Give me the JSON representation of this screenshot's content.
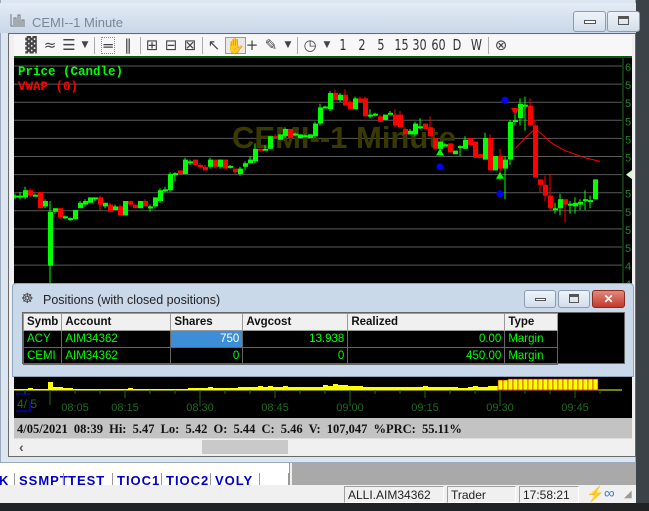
{
  "window": {
    "title": "CEMI--1 Minute",
    "watermark": "CEMI--1 Minute"
  },
  "toolbar": {
    "icons": [
      "chart-type-icon",
      "draw-style-icon",
      "indicator-icon",
      "dropdown-icon",
      "horizontal-split-icon",
      "vertical-split-icon",
      "zoom-in-icon",
      "zoom-fit-icon",
      "zoom-out-icon",
      "cursor-icon",
      "hand-icon",
      "crosshair-icon",
      "pencil-icon",
      "dropdown-icon",
      "clock-icon",
      "dropdown-icon",
      "close-circle-icon"
    ],
    "intervals": [
      "1",
      "2",
      "5",
      "15",
      "30",
      "60",
      "D",
      "W"
    ]
  },
  "legend": {
    "price": "Price (Candle)",
    "vwap": "VWAP (0)"
  },
  "colors": {
    "up": "#00ff00",
    "down": "#ff0000",
    "vwap": "#ff0000",
    "grid": "#5a5a5a",
    "axis": "#1f6b1f",
    "volume": "#ffff00",
    "watermark": "#3a3a00"
  },
  "chart_data": {
    "type": "candlestick",
    "title": "CEMI--1 Minute",
    "date_label": "4/ 5",
    "x_ticks": [
      "08:05",
      "08:15",
      "08:30",
      "08:45",
      "09:00",
      "09:15",
      "09:30",
      "09:45"
    ],
    "y_axis_labels": [
      "6.",
      "5.",
      "5.",
      "5.",
      "5.",
      "5.",
      "5.",
      "5.",
      "5.",
      "5.",
      "5.",
      "4.",
      "4"
    ],
    "ylim": [
      4.8,
      6.0
    ],
    "candles_columns": [
      "time",
      "open",
      "high",
      "low",
      "close"
    ],
    "candles": [
      [
        "07:53",
        5.27,
        5.29,
        5.26,
        5.28
      ],
      [
        "07:54",
        5.27,
        5.3,
        5.26,
        5.28
      ],
      [
        "07:55",
        5.27,
        5.33,
        5.26,
        5.31
      ],
      [
        "07:56",
        5.31,
        5.32,
        5.27,
        5.28
      ],
      [
        "07:57",
        5.28,
        5.29,
        5.28,
        5.285
      ],
      [
        "07:58",
        5.3,
        5.3,
        5.21,
        5.21
      ],
      [
        "07:59",
        5.22,
        5.26,
        5.21,
        5.25
      ],
      [
        "08:00",
        4.89,
        5.25,
        4.78,
        5.19
      ],
      [
        "08:01",
        5.19,
        5.21,
        5.18,
        5.21
      ],
      [
        "08:02",
        5.21,
        5.21,
        5.15,
        5.16
      ],
      [
        "08:03",
        5.16,
        5.17,
        5.15,
        5.165
      ],
      [
        "08:04",
        5.15,
        5.16,
        5.14,
        5.155
      ],
      [
        "08:05",
        5.15,
        5.2,
        5.15,
        5.2
      ],
      [
        "08:06",
        5.21,
        5.25,
        5.21,
        5.24
      ],
      [
        "08:07",
        5.23,
        5.26,
        5.22,
        5.25
      ],
      [
        "08:08",
        5.24,
        5.27,
        5.24,
        5.27
      ],
      [
        "08:09",
        5.26,
        5.27,
        5.25,
        5.27
      ],
      [
        "08:10",
        5.27,
        5.28,
        5.2,
        5.23
      ],
      [
        "08:11",
        5.22,
        5.24,
        5.21,
        5.24
      ],
      [
        "08:12",
        5.23,
        5.24,
        5.19,
        5.19
      ],
      [
        "08:13",
        5.2,
        5.23,
        5.2,
        5.22
      ],
      [
        "08:14",
        5.22,
        5.23,
        5.17,
        5.17
      ],
      [
        "08:15",
        5.17,
        5.25,
        5.17,
        5.25
      ],
      [
        "08:16",
        5.25,
        5.25,
        5.22,
        5.23
      ],
      [
        "08:17",
        5.23,
        5.23,
        5.21,
        5.21
      ],
      [
        "08:18",
        5.21,
        5.25,
        5.21,
        5.25
      ],
      [
        "08:19",
        5.25,
        5.26,
        5.22,
        5.22
      ],
      [
        "08:20",
        5.21,
        5.23,
        5.19,
        5.22
      ],
      [
        "08:21",
        5.22,
        5.27,
        5.21,
        5.27
      ],
      [
        "08:22",
        5.25,
        5.32,
        5.24,
        5.31
      ],
      [
        "08:23",
        5.31,
        5.33,
        5.3,
        5.315
      ],
      [
        "08:24",
        5.31,
        5.41,
        5.3,
        5.4
      ],
      [
        "08:25",
        5.4,
        5.41,
        5.36,
        5.405
      ],
      [
        "08:26",
        5.42,
        5.42,
        5.4,
        5.4
      ],
      [
        "08:27",
        5.4,
        5.49,
        5.4,
        5.48
      ],
      [
        "08:28",
        5.46,
        5.48,
        5.45,
        5.47
      ],
      [
        "08:29",
        5.48,
        5.48,
        5.45,
        5.45
      ],
      [
        "08:30",
        5.45,
        5.46,
        5.43,
        5.44
      ],
      [
        "08:31",
        5.44,
        5.45,
        5.42,
        5.42
      ],
      [
        "08:32",
        5.44,
        5.49,
        5.43,
        5.48
      ],
      [
        "08:33",
        5.48,
        5.48,
        5.43,
        5.44
      ],
      [
        "08:34",
        5.44,
        5.48,
        5.43,
        5.48
      ],
      [
        "08:35",
        5.48,
        5.48,
        5.43,
        5.43
      ],
      [
        "08:36",
        5.44,
        5.45,
        5.43,
        5.445
      ],
      [
        "08:37",
        5.43,
        5.43,
        5.4,
        5.41
      ],
      [
        "08:38",
        5.4,
        5.44,
        5.39,
        5.43
      ],
      [
        "08:39",
        5.44,
        5.47,
        5.42,
        5.46
      ],
      [
        "08:40",
        5.46,
        5.5,
        5.46,
        5.48
      ],
      [
        "08:41",
        5.47,
        5.57,
        5.46,
        5.54
      ],
      [
        "08:42",
        5.54,
        5.54,
        5.53,
        5.53
      ],
      [
        "08:43",
        5.53,
        5.56,
        5.53,
        5.54
      ],
      [
        "08:44",
        5.54,
        5.61,
        5.54,
        5.61
      ],
      [
        "08:45",
        5.61,
        5.62,
        5.6,
        5.6
      ],
      [
        "08:46",
        5.59,
        5.62,
        5.59,
        5.62
      ],
      [
        "08:47",
        5.61,
        5.66,
        5.6,
        5.65
      ],
      [
        "08:48",
        5.65,
        5.65,
        5.6,
        5.6
      ],
      [
        "08:49",
        5.62,
        5.63,
        5.61,
        5.625
      ],
      [
        "08:50",
        5.6,
        5.62,
        5.6,
        5.62
      ],
      [
        "08:51",
        5.61,
        5.62,
        5.61,
        5.615
      ],
      [
        "08:52",
        5.6,
        5.62,
        5.6,
        5.62
      ],
      [
        "08:53",
        5.61,
        5.69,
        5.6,
        5.68
      ],
      [
        "08:54",
        5.68,
        5.79,
        5.67,
        5.77
      ],
      [
        "08:55",
        5.77,
        5.78,
        5.77,
        5.775
      ],
      [
        "08:56",
        5.76,
        5.86,
        5.75,
        5.85
      ],
      [
        "08:57",
        5.85,
        5.87,
        5.81,
        5.81
      ],
      [
        "08:58",
        5.81,
        5.85,
        5.8,
        5.84
      ],
      [
        "08:59",
        5.84,
        5.87,
        5.78,
        5.78
      ],
      [
        "09:00",
        5.8,
        5.81,
        5.76,
        5.76
      ],
      [
        "09:01",
        5.76,
        5.83,
        5.76,
        5.82
      ],
      [
        "09:02",
        5.82,
        5.83,
        5.8,
        5.8
      ],
      [
        "09:03",
        5.82,
        5.83,
        5.72,
        5.72
      ],
      [
        "09:04",
        5.72,
        5.76,
        5.71,
        5.73
      ],
      [
        "09:05",
        5.73,
        5.74,
        5.72,
        5.735
      ],
      [
        "09:06",
        5.72,
        5.73,
        5.69,
        5.69
      ],
      [
        "09:07",
        5.7,
        5.73,
        5.7,
        5.73
      ],
      [
        "09:08",
        5.73,
        5.75,
        5.73,
        5.74
      ],
      [
        "09:09",
        5.73,
        5.76,
        5.66,
        5.67
      ],
      [
        "09:10",
        5.73,
        5.75,
        5.66,
        5.66
      ],
      [
        "09:11",
        5.65,
        5.66,
        5.62,
        5.62
      ],
      [
        "09:12",
        5.62,
        5.65,
        5.62,
        5.64
      ],
      [
        "09:13",
        5.62,
        5.69,
        5.61,
        5.68
      ],
      [
        "09:14",
        5.66,
        5.71,
        5.65,
        5.665
      ],
      [
        "09:15",
        5.68,
        5.68,
        5.65,
        5.65
      ],
      [
        "09:16",
        5.66,
        5.72,
        5.61,
        5.61
      ],
      [
        "09:17",
        5.6,
        5.6,
        5.54,
        5.54
      ],
      [
        "09:18",
        5.54,
        5.58,
        5.53,
        5.58
      ],
      [
        "09:19",
        5.56,
        5.57,
        5.56,
        5.565
      ],
      [
        "09:20",
        5.57,
        5.57,
        5.52,
        5.52
      ],
      [
        "09:21",
        5.51,
        5.53,
        5.51,
        5.53
      ],
      [
        "09:22",
        5.55,
        5.56,
        5.5,
        5.555
      ],
      [
        "09:23",
        5.54,
        5.61,
        5.54,
        5.59
      ],
      [
        "09:24",
        5.6,
        5.6,
        5.56,
        5.56
      ],
      [
        "09:25",
        5.58,
        5.58,
        5.49,
        5.49
      ],
      [
        "09:26",
        5.51,
        5.51,
        5.49,
        5.49
      ],
      [
        "09:27",
        5.48,
        5.63,
        5.48,
        5.6
      ],
      [
        "09:28",
        5.6,
        5.62,
        5.42,
        5.42
      ],
      [
        "09:29",
        5.42,
        5.5,
        5.42,
        5.5
      ],
      [
        "09:30",
        5.5,
        5.54,
        5.36,
        5.43
      ],
      [
        "09:31",
        5.43,
        5.5,
        5.26,
        5.48
      ],
      [
        "09:32",
        5.48,
        5.7,
        5.45,
        5.69
      ],
      [
        "09:33",
        5.69,
        5.76,
        5.67,
        5.7
      ],
      [
        "09:34",
        5.71,
        5.82,
        5.67,
        5.79
      ],
      [
        "09:35",
        5.78,
        5.83,
        5.64,
        5.785
      ],
      [
        "09:36",
        5.78,
        5.82,
        5.67,
        5.67
      ],
      [
        "09:37",
        5.67,
        5.7,
        5.38,
        5.38
      ],
      [
        "09:38",
        5.37,
        5.37,
        5.3,
        5.34
      ],
      [
        "09:39",
        5.34,
        5.39,
        5.25,
        5.28
      ],
      [
        "09:40",
        5.28,
        5.4,
        5.2,
        5.21
      ],
      [
        "09:41",
        5.2,
        5.24,
        5.18,
        5.21
      ],
      [
        "09:42",
        5.21,
        5.29,
        5.17,
        5.26
      ],
      [
        "09:43",
        5.26,
        5.26,
        5.13,
        5.23
      ],
      [
        "09:44",
        5.23,
        5.25,
        5.18,
        5.235
      ],
      [
        "09:45",
        5.22,
        5.27,
        5.18,
        5.24
      ],
      [
        "09:46",
        5.23,
        5.26,
        5.2,
        5.245
      ],
      [
        "09:47",
        5.25,
        5.31,
        5.2,
        5.26
      ],
      [
        "09:48",
        5.25,
        5.28,
        5.21,
        5.255
      ],
      [
        "09:49",
        5.26,
        5.37,
        5.26,
        5.37
      ]
    ],
    "volume_relative": [
      1,
      1,
      1,
      2,
      1,
      1,
      1,
      8,
      3,
      3,
      2,
      2,
      1,
      1,
      1,
      1,
      1,
      1,
      1,
      1,
      1,
      1,
      1,
      2,
      1,
      1,
      1,
      1,
      1,
      1,
      1,
      1,
      1,
      1,
      1,
      2,
      2,
      2,
      2,
      3,
      2,
      2,
      2,
      2,
      2,
      3,
      3,
      3,
      3,
      4,
      3,
      4,
      3,
      3,
      4,
      3,
      3,
      3,
      3,
      3,
      3,
      3,
      5,
      4,
      6,
      5,
      5,
      4,
      4,
      4,
      3,
      3,
      3,
      3,
      3,
      3,
      3,
      3,
      3,
      3,
      3,
      3,
      4,
      3,
      3,
      3,
      3,
      3,
      3,
      2,
      2,
      3,
      4,
      3,
      3,
      4,
      4,
      10,
      10,
      11,
      11,
      11,
      11,
      11,
      11,
      11,
      11,
      11,
      11,
      11,
      11,
      11,
      11,
      11,
      11,
      11,
      11
    ],
    "vwap": [
      [
        "09:33",
        5.54
      ],
      [
        "09:35",
        5.6
      ],
      [
        "09:37",
        5.65
      ],
      [
        "09:38",
        5.63
      ],
      [
        "09:40",
        5.58
      ],
      [
        "09:41",
        5.56
      ],
      [
        "09:43",
        5.53
      ],
      [
        "09:45",
        5.51
      ],
      [
        "09:47",
        5.49
      ],
      [
        "09:50",
        5.47
      ]
    ],
    "markers": [
      {
        "type": "dot",
        "color": "#0000ff",
        "time": "09:31",
        "price": 5.81
      },
      {
        "type": "dot",
        "color": "#0000ff",
        "time": "09:18",
        "price": 5.44
      },
      {
        "type": "dot",
        "color": "#0000ff",
        "time": "09:30",
        "price": 5.29
      },
      {
        "type": "triangle-up",
        "color": "#00ff00",
        "time": "09:18",
        "price": 5.52
      },
      {
        "type": "triangle-up",
        "color": "#00ff00",
        "time": "09:30",
        "price": 5.39
      },
      {
        "type": "triangle-down",
        "color": "#ff0000",
        "time": "09:33",
        "price": 5.75
      }
    ]
  },
  "status_line": "4/05/2021 08:39  Hi: 5.47  Lo: 5.42  O: 5.44  C: 5.46  V: 107,047 %PRC: 55.11%",
  "positions": {
    "title": "Positions (with closed positions)",
    "columns": [
      "Symb",
      "Account",
      "Shares",
      "Avgcost",
      "Realized",
      "Type"
    ],
    "rows": [
      {
        "symb": "ACY",
        "account": "AIM34362",
        "shares": "750",
        "avgcost": "13.938",
        "realized": "0.00",
        "type": "Margin"
      },
      {
        "symb": "CEMI",
        "account": "AIM34362",
        "shares": "0",
        "avgcost": "0",
        "realized": "450.00",
        "type": "Margin"
      }
    ]
  },
  "tabs": [
    "K",
    "SSMPT",
    "TEST",
    "TIOC1",
    "TIOC2",
    "VOLY"
  ],
  "statusbar": {
    "account": "ALLI.AIM34362",
    "role": "Trader",
    "time": "17:58:21"
  }
}
